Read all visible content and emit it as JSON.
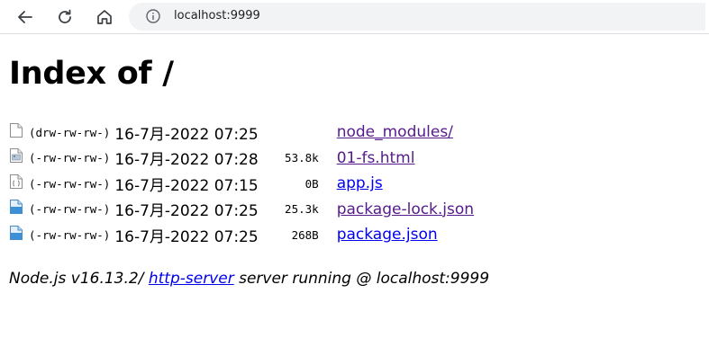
{
  "browser": {
    "url": "localhost:9999",
    "icons": [
      "back-arrow-icon",
      "reload-icon",
      "home-icon",
      "info-icon"
    ]
  },
  "page": {
    "title": "Index of /",
    "entries": [
      {
        "icon": "folder-icon",
        "perms": "(drw-rw-rw-)",
        "date": "16-7月-2022 07:25",
        "size": "",
        "name": "node_modules/",
        "visited": true
      },
      {
        "icon": "html-file-icon",
        "perms": "(-rw-rw-rw-)",
        "date": "16-7月-2022 07:28",
        "size": "53.8k",
        "name": "01-fs.html",
        "visited": true
      },
      {
        "icon": "js-file-icon",
        "perms": "(-rw-rw-rw-)",
        "date": "16-7月-2022 07:15",
        "size": "0B",
        "name": "app.js",
        "visited": false
      },
      {
        "icon": "json-file-icon",
        "perms": "(-rw-rw-rw-)",
        "date": "16-7月-2022 07:25",
        "size": "25.3k",
        "name": "package-lock.json",
        "visited": true
      },
      {
        "icon": "json-file-icon",
        "perms": "(-rw-rw-rw-)",
        "date": "16-7月-2022 07:25",
        "size": "268B",
        "name": "package.json",
        "visited": false
      }
    ],
    "footer": {
      "prefix": "Node.js v16.13.2/ ",
      "link": "http-server",
      "suffix": " server running @ localhost:9999"
    }
  },
  "colors": {
    "link": "#0000ee",
    "visited_link": "#551a8b",
    "omnibox_bg": "#f1f3f4"
  }
}
